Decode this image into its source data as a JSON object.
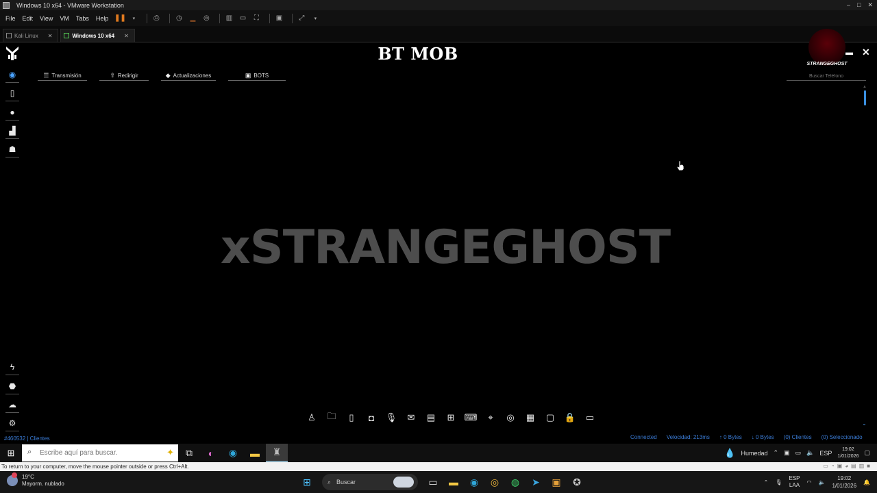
{
  "window": {
    "title": "Windows 10 x64 - VMware Workstation",
    "buttons": {
      "minimize": "–",
      "maximize": "□",
      "close": "✕"
    }
  },
  "menu": [
    "File",
    "Edit",
    "View",
    "VM",
    "Tabs",
    "Help"
  ],
  "vm_tabs": [
    {
      "label": "Kali Linux",
      "active": false
    },
    {
      "label": "Windows 10 x64",
      "active": true
    }
  ],
  "app": {
    "title": "BT MOB",
    "watermark": "xSTRANGEGHOST",
    "brand_label": "STRANGEGHOST",
    "search_placeholder": "Buscar Teléfono",
    "nav_tabs": [
      {
        "label": "Transmisión",
        "icon": "rss-icon",
        "glyph": "☰"
      },
      {
        "label": "Redirigir",
        "icon": "upload-icon",
        "glyph": "⇧"
      },
      {
        "label": "Actualizaciones",
        "icon": "dropbox-icon",
        "glyph": "◆"
      },
      {
        "label": "BOTS",
        "icon": "bot-icon",
        "glyph": "▣"
      }
    ],
    "client_count": "#460532 | Clientes",
    "status": {
      "connection": "Connected",
      "speed": "Velocidad: 213ms",
      "upload": "↑ 0 Bytes",
      "download": "↓ 0 Bytes",
      "clients": "(0) Clientes",
      "selected": "(0) Seleccionado"
    }
  },
  "guest_taskbar": {
    "search_placeholder": "Escribe aquí para buscar.",
    "humidity": "Humedad",
    "lang": "ESP",
    "time": "19:02",
    "date": "1/01/2026"
  },
  "vm_status": "To return to your computer, move the mouse pointer outside or press Ctrl+Alt.",
  "host_taskbar": {
    "weather_temp": "19°C",
    "weather_desc": "Mayorm. nublado",
    "search_label": "Buscar",
    "lang_top": "ESP",
    "lang_bottom": "LAA",
    "time": "19:02",
    "date": "1/01/2026"
  },
  "colors": {
    "accent": "#3b7dd8",
    "watermark": "#4d4d4d",
    "background": "#000000"
  }
}
